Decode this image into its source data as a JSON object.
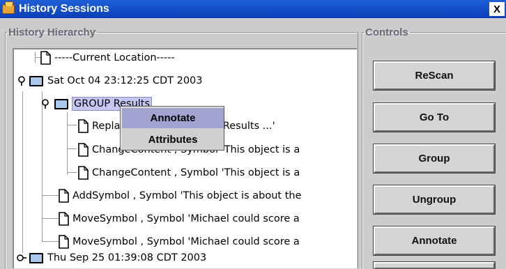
{
  "window": {
    "title": "History Sessions",
    "close_label": "X",
    "app_icon": "coffee-cup-icon"
  },
  "history_hierarchy": {
    "legend": "History Hierarchy",
    "rows": [
      {
        "label": "-----Current Location-----",
        "icon": "document-icon"
      },
      {
        "label": "Sat Oct 04 23:12:25 CDT 2003",
        "icon": "folder-icon",
        "handle": "expanded"
      },
      {
        "label": "GROUP Results",
        "icon": "folder-icon",
        "handle": "expanded",
        "selected": true
      },
      {
        "label": "ReplaceSymbol , Symbol 'Results ...'",
        "icon": "document-icon"
      },
      {
        "label": "ChangeContent , Symbol 'This object is a",
        "icon": "document-icon"
      },
      {
        "label": "ChangeContent , Symbol 'This object is a",
        "icon": "document-icon"
      },
      {
        "label": "AddSymbol , Symbol 'This object is about the",
        "icon": "document-icon"
      },
      {
        "label": "MoveSymbol , Symbol 'Michael could score a",
        "icon": "document-icon"
      },
      {
        "label": "MoveSymbol , Symbol 'Michael could score a",
        "icon": "document-icon"
      },
      {
        "label": "Thu Sep 25 01:39:08 CDT 2003",
        "icon": "folder-icon",
        "handle": "collapsed"
      }
    ]
  },
  "context_menu": {
    "items": [
      {
        "label": "Annotate",
        "highlighted": true
      },
      {
        "label": "Attributes",
        "highlighted": false
      }
    ]
  },
  "controls": {
    "legend": "Controls",
    "buttons": [
      {
        "label": "ReScan"
      },
      {
        "label": "Go To"
      },
      {
        "label": "Group"
      },
      {
        "label": "Ungroup"
      },
      {
        "label": "Annotate"
      }
    ]
  },
  "colors": {
    "titlebar": "#0b3fb8",
    "selection": "#c6c6f3",
    "menu_highlight": "#a3a3d1",
    "folder": "#a8c8ee"
  }
}
